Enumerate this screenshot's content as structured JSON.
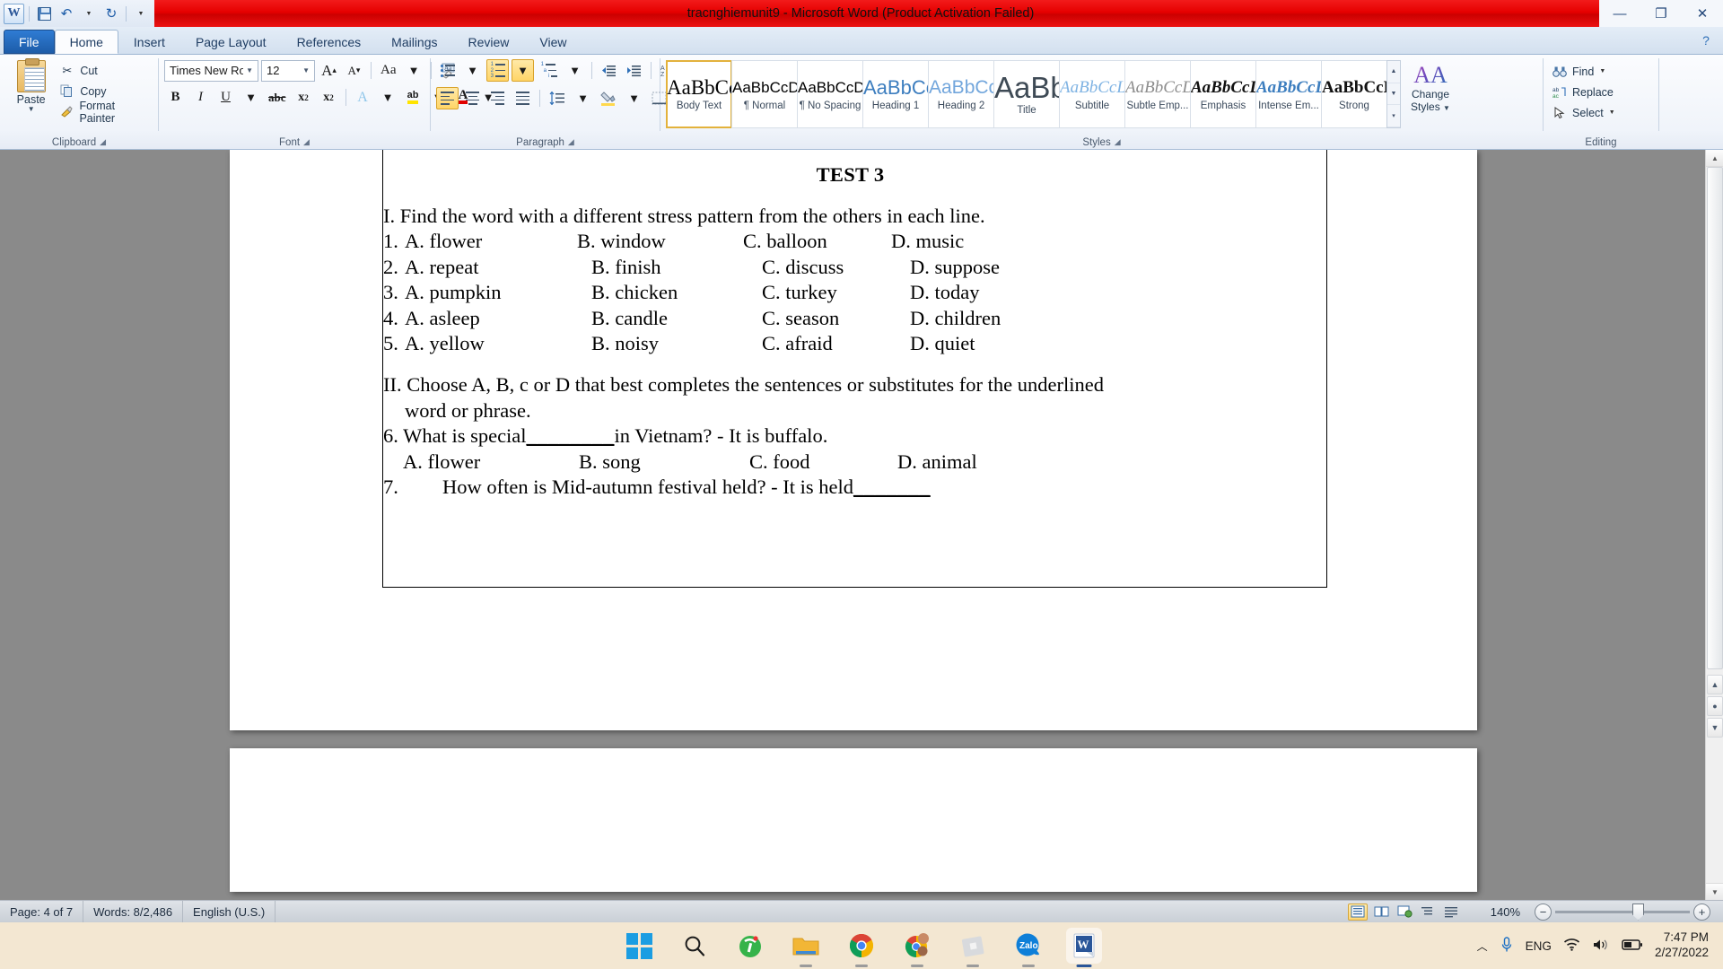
{
  "window": {
    "title": "tracnghiemunit9  -  Microsoft Word (Product Activation Failed)",
    "app_logo": "word-logo",
    "quick_access": [
      {
        "name": "save-icon",
        "label": "Save"
      },
      {
        "name": "undo-icon",
        "label": "Undo"
      },
      {
        "name": "undo-dropdown-icon",
        "label": "Undo options"
      },
      {
        "name": "redo-icon",
        "label": "Redo"
      },
      {
        "name": "customize-qat-icon",
        "label": "Customize Quick Access Toolbar"
      }
    ],
    "controls": {
      "minimize": "—",
      "restore": "❐",
      "close": "✕",
      "help": "?"
    },
    "titlebar_color": "#e60000"
  },
  "tabs": [
    {
      "label": "File",
      "state": "file"
    },
    {
      "label": "Home",
      "state": "active"
    },
    {
      "label": "Insert",
      "state": "normal"
    },
    {
      "label": "Page Layout",
      "state": "normal"
    },
    {
      "label": "References",
      "state": "normal"
    },
    {
      "label": "Mailings",
      "state": "normal"
    },
    {
      "label": "Review",
      "state": "normal"
    },
    {
      "label": "View",
      "state": "normal"
    }
  ],
  "ribbon": {
    "clipboard": {
      "group_label": "Clipboard",
      "paste_label": "Paste",
      "commands": [
        {
          "label": "Cut",
          "icon": "scissors-icon"
        },
        {
          "label": "Copy",
          "icon": "copy-icon"
        },
        {
          "label": "Format Painter",
          "icon": "format-painter-icon"
        }
      ]
    },
    "font": {
      "group_label": "Font",
      "font_name": "Times New Roma",
      "font_size": "12",
      "grow_label": "A",
      "shrink_label": "A",
      "change_case_label": "Aa",
      "clear_formatting_label": "Aa",
      "bold_label": "B",
      "italic_label": "I",
      "underline_label": "U",
      "strike_label": "abc",
      "subscript_label": "x",
      "superscript_label": "x",
      "text_effects_label": "A",
      "highlight_label": "ab",
      "font_color_label": "A"
    },
    "paragraph": {
      "group_label": "Paragraph",
      "bullets": "bullets-icon",
      "numbering": "numbering-icon",
      "multilevel": "multilevel-list-icon",
      "decrease_indent": "decrease-indent-icon",
      "increase_indent": "increase-indent-icon",
      "sort": "sort-icon",
      "show_marks": "¶",
      "align_left": "align-left-icon",
      "align_center": "align-center-icon",
      "align_right": "align-right-icon",
      "justify": "justify-icon",
      "line_spacing": "line-spacing-icon",
      "shading": "shading-icon",
      "borders": "borders-icon"
    },
    "styles": {
      "group_label": "Styles",
      "gallery": [
        {
          "preview": "AaBbCc",
          "name": "Body Text",
          "selected": true,
          "style": "serif-normal"
        },
        {
          "preview": "AaBbCcDd",
          "name": "¶ Normal",
          "selected": false,
          "style": "sans-normal"
        },
        {
          "preview": "AaBbCcDd",
          "name": "¶ No Spacing",
          "selected": false,
          "style": "sans-normal"
        },
        {
          "preview": "AaBbCc",
          "name": "Heading 1",
          "selected": false,
          "style": "blue-large"
        },
        {
          "preview": "AaBbCcI",
          "name": "Heading 2",
          "selected": false,
          "style": "blue-light"
        },
        {
          "preview": "AaBb",
          "name": "Title",
          "selected": false,
          "style": "title-huge"
        },
        {
          "preview": "AaBbCcL",
          "name": "Subtitle",
          "selected": false,
          "style": "italic-blue"
        },
        {
          "preview": "AaBbCcDd",
          "name": "Subtle Emp...",
          "selected": false,
          "style": "italic-gray"
        },
        {
          "preview": "AaBbCcDd",
          "name": "Emphasis",
          "selected": false,
          "style": "serif-bolditalic"
        },
        {
          "preview": "AaBbCcD",
          "name": "Intense Em...",
          "selected": false,
          "style": "serif-blue-bolditalic"
        },
        {
          "preview": "AaBbCcD",
          "name": "Strong",
          "selected": false,
          "style": "serif-bold"
        }
      ],
      "change_styles_label": "Change\nStyles",
      "change_styles_line1": "Change",
      "change_styles_line2": "Styles"
    },
    "editing": {
      "group_label": "Editing",
      "commands": [
        {
          "label": "Find",
          "icon": "binoculars-icon",
          "dropdown": true
        },
        {
          "label": "Replace",
          "icon": "replace-icon",
          "dropdown": false
        },
        {
          "label": "Select",
          "icon": "cursor-icon",
          "dropdown": true
        }
      ]
    }
  },
  "document": {
    "title": "TEST 3",
    "section_1": {
      "heading": "I. Find the word with a different stress pattern from the others in each line.",
      "questions": [
        {
          "num": "1.",
          "a": "A. flower",
          "b": "B. window",
          "c": "C. balloon",
          "d": "D. music"
        },
        {
          "num": "2.",
          "a": "A. repeat",
          "b": "B. finish",
          "c": "C. discuss",
          "d": "D. suppose"
        },
        {
          "num": "3.",
          "a": "A. pumpkin",
          "b": "B. chicken",
          "c": "C. turkey",
          "d": "D. today"
        },
        {
          "num": "4.",
          "a": "A. asleep",
          "b": "B. candle",
          "c": "C. season",
          "d": "D. children"
        },
        {
          "num": "5.",
          "a": "A. yellow",
          "b": "B. noisy",
          "c": "C. afraid",
          "d": "D. quiet"
        }
      ]
    },
    "section_2": {
      "heading_line1": "II. Choose A, B, c or D that best completes the sentences or substitutes for the underlined",
      "heading_line2": "word or phrase.",
      "q6_pre": "6. What is special",
      "q6_blank": "________",
      "q6_post": "in Vietnam? - It is buffalo.",
      "q6_options": {
        "a": "A. flower",
        "b": "B. song",
        "c": "C. food",
        "d": "D. animal"
      },
      "q7_num": "7.",
      "q7_text": "How often is Mid-autumn festival held? - It is held",
      "q7_blank": "_______"
    }
  },
  "status_bar": {
    "page": "Page: 4 of 7",
    "words": "Words: 8/2,486",
    "language": "English (U.S.)",
    "zoom_level": "140%",
    "views": [
      {
        "name": "print-layout-view",
        "selected": true
      },
      {
        "name": "full-screen-reading-view",
        "selected": false
      },
      {
        "name": "web-layout-view",
        "selected": false
      },
      {
        "name": "outline-view",
        "selected": false
      },
      {
        "name": "draft-view",
        "selected": false
      }
    ],
    "zoom_out": "−",
    "zoom_in": "+"
  },
  "taskbar": {
    "items": [
      {
        "name": "start-button",
        "label": "Start",
        "running": false
      },
      {
        "name": "search-icon",
        "label": "Search",
        "running": false
      },
      {
        "name": "unikey-icon",
        "label": "Unikey",
        "running": false
      },
      {
        "name": "file-explorer-icon",
        "label": "File Explorer",
        "running": true
      },
      {
        "name": "chrome-icon",
        "label": "Google Chrome",
        "running": true
      },
      {
        "name": "chrome-profile-icon",
        "label": "Chrome profiles",
        "running": true
      },
      {
        "name": "roblox-icon",
        "label": "Roblox",
        "running": true
      },
      {
        "name": "zalo-icon",
        "label": "Zalo",
        "running": true
      },
      {
        "name": "word-taskbar-icon",
        "label": "Microsoft Word",
        "running": true,
        "active": true
      }
    ],
    "tray": {
      "show_hidden": "︿",
      "mic": "mic-icon",
      "language": "ENG",
      "wifi": "wifi-icon",
      "volume": "volume-icon",
      "battery": "battery-icon",
      "time": "7:47 PM",
      "date": "2/27/2022"
    }
  }
}
